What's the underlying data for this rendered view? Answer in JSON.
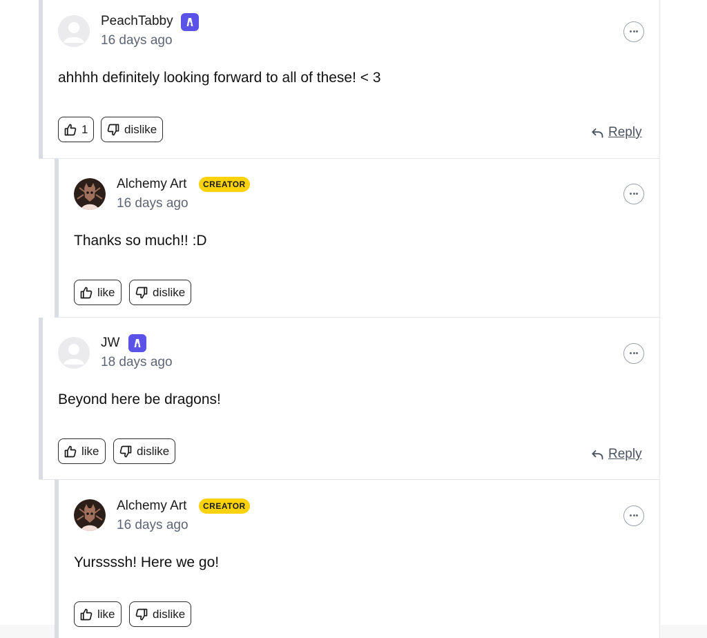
{
  "comments": [
    {
      "author": "PeachTabby",
      "author_type": "patron",
      "time": "16 days ago",
      "text": "ahhhh definitely looking forward to all of these! < 3",
      "like_label": "1",
      "dislike_label": "dislike",
      "reply_label": "Reply"
    },
    {
      "author": "Alchemy Art",
      "author_type": "creator",
      "badge": "CREATOR",
      "time": "16 days ago",
      "text": "Thanks so much!! :D",
      "like_label": "like",
      "dislike_label": "dislike"
    },
    {
      "author": "JW",
      "author_type": "patron",
      "time": "18 days ago",
      "text": "Beyond here be dragons!",
      "like_label": "like",
      "dislike_label": "dislike",
      "reply_label": "Reply"
    },
    {
      "author": "Alchemy Art",
      "author_type": "creator",
      "badge": "CREATOR",
      "time": "16 days ago",
      "text": "Yurssssh! Here we go!",
      "like_label": "like",
      "dislike_label": "dislike"
    }
  ],
  "colors": {
    "patron_badge": "#5b52e8",
    "creator_badge": "#fcd20b",
    "thread_bar": "#d9dde3",
    "timestamp": "#5d6575"
  },
  "icons": [
    "more-options-icon",
    "thumbs-up-icon",
    "thumbs-down-icon",
    "reply-arrow-icon",
    "patron-badge-icon"
  ]
}
